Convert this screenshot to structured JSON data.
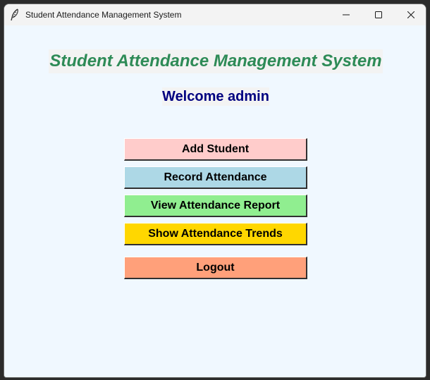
{
  "window": {
    "title": "Student Attendance Management System",
    "app_icon": "feather-icon"
  },
  "controls": {
    "minimize_icon": "minimize-icon",
    "maximize_icon": "maximize-icon",
    "close_icon": "close-icon"
  },
  "main": {
    "heading": "Student Attendance Management System",
    "welcome": "Welcome admin",
    "colors": {
      "background": "#f0f8ff",
      "heading": "#2e8b57",
      "welcome": "#000080"
    },
    "buttons": [
      {
        "label": "Add Student",
        "color": "#ffcccb"
      },
      {
        "label": "Record Attendance",
        "color": "#add8e6"
      },
      {
        "label": "View Attendance Report",
        "color": "#90ee90"
      },
      {
        "label": "Show Attendance Trends",
        "color": "#ffd700"
      },
      {
        "label": "Logout",
        "color": "#ffa07a"
      }
    ]
  }
}
